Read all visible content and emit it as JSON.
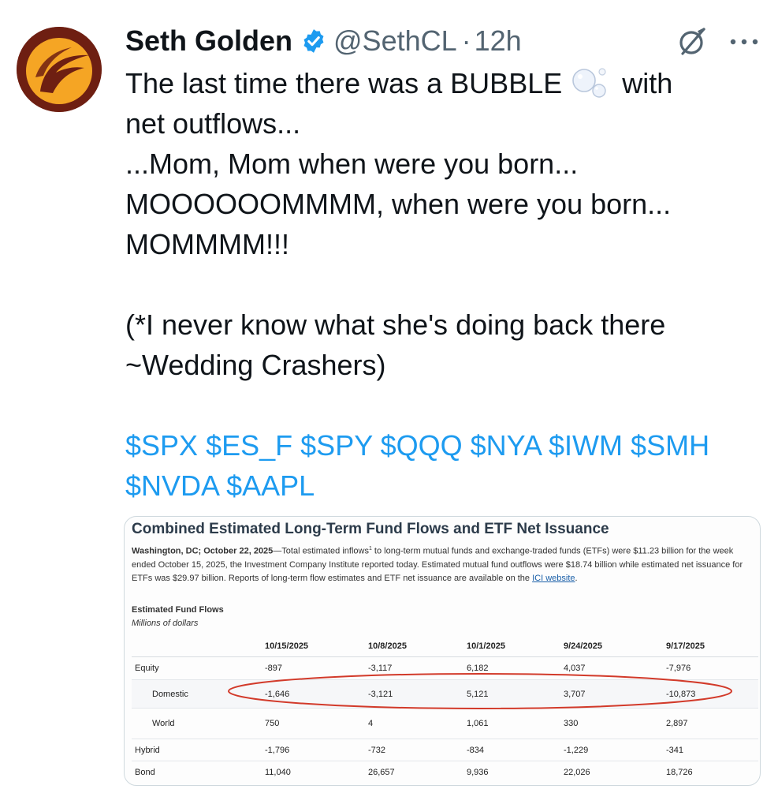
{
  "tweet": {
    "author_name": "Seth Golden",
    "handle": "@SethCL",
    "separator": "·",
    "time": "12h",
    "lines": {
      "l1a": "The last time there was a BUBBLE",
      "l1b": "with",
      "l2": "net outflows...",
      "l3": "...Mom, Mom when were you born...",
      "l4": "MOOOOOOMMMM, when were you born...",
      "l5": "MOMMMM!!!",
      "l6": "(*I never know what she's doing back there",
      "l7": "~Wedding Crashers)"
    },
    "cashtags": [
      "$SPX",
      "$ES_F",
      "$SPY",
      "$QQQ",
      "$NYA",
      "$IWM",
      "$SMH",
      "$NVDA",
      "$AAPL"
    ],
    "icons": {
      "verified": "verified-badge-icon",
      "bubble": "bubbles-emoji-icon",
      "grok": "grok-icon",
      "more": "more-dots-icon"
    },
    "colors": {
      "link": "#1d9bf0",
      "text": "#0f1419",
      "secondary": "#536471",
      "avatar_bg": "#6e1f12",
      "avatar_logo": "#f5a524",
      "annotation": "#d23a2a"
    }
  },
  "media": {
    "title": "Combined Estimated Long-Term Fund Flows and ETF Net Issuance",
    "para_dateline": "Washington, DC; October 22, 2025",
    "para_body1": "—Total estimated inflows",
    "para_sup": "1",
    "para_body2": " to long-term mutual funds and exchange-traded funds (ETFs) were $11.23 billion for the week ended October 15, 2025, the Investment Company Institute reported today. Estimated mutual fund outflows were $18.74 billion while estimated net issuance for ETFs was $29.97 billion. Reports of long-term flow estimates and ETF net issuance are available on the ",
    "para_link": "ICI website",
    "para_end": ".",
    "table_heading": "Estimated Fund Flows",
    "table_unit": "Millions of dollars",
    "columns": [
      "10/15/2025",
      "10/8/2025",
      "10/1/2025",
      "9/24/2025",
      "9/17/2025"
    ],
    "rows": [
      {
        "label": "Equity",
        "values": [
          "-897",
          "-3,117",
          "6,182",
          "4,037",
          "-7,976"
        ]
      },
      {
        "label": "Domestic",
        "values": [
          "-1,646",
          "-3,121",
          "5,121",
          "3,707",
          "-10,873"
        ]
      },
      {
        "label": "World",
        "values": [
          "750",
          "4",
          "1,061",
          "330",
          "2,897"
        ]
      },
      {
        "label": "Hybrid",
        "values": [
          "-1,796",
          "-732",
          "-834",
          "-1,229",
          "-341"
        ]
      },
      {
        "label": "Bond",
        "values": [
          "11,040",
          "26,657",
          "9,936",
          "22,026",
          "18,726"
        ]
      }
    ]
  }
}
